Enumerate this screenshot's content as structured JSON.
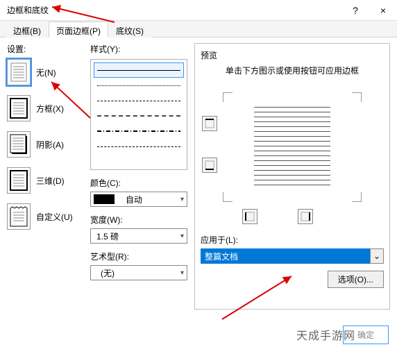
{
  "window": {
    "title": "边框和底纹",
    "help": "?",
    "close": "×"
  },
  "tabs": {
    "border": "边框(B)",
    "page_border": "页面边框(P)",
    "shading": "底纹(S)"
  },
  "settings": {
    "label": "设置:",
    "none": "无(N)",
    "box": "方框(X)",
    "shadow": "阴影(A)",
    "threed": "三维(D)",
    "custom": "自定义(U)"
  },
  "style": {
    "label": "样式(Y):",
    "color_label": "颜色(C):",
    "color_value": "自动",
    "width_label": "宽度(W):",
    "width_value": "1.5 磅",
    "art_label": "艺术型(R):",
    "art_value": "(无)"
  },
  "preview": {
    "label": "预览",
    "hint": "单击下方图示或使用按钮可应用边框",
    "apply_label": "应用于(L):",
    "apply_value": "整篇文档",
    "options": "选项(O)..."
  },
  "footer": {
    "ok": "确定"
  },
  "watermark": "天成手游网"
}
